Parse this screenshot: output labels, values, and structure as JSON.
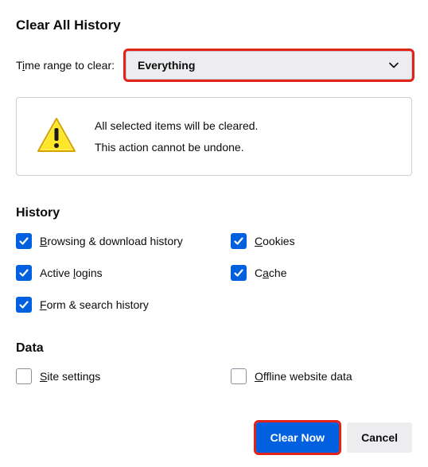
{
  "title": "Clear All History",
  "timeRange": {
    "label_pre": "T",
    "label_u": "i",
    "label_post": "me range to clear:",
    "selected": "Everything"
  },
  "warning": {
    "line1": "All selected items will be cleared.",
    "line2": "This action cannot be undone."
  },
  "sections": {
    "history": {
      "title": "History",
      "items": [
        {
          "u": "B",
          "rest": "rowsing & download history",
          "checked": true
        },
        {
          "u": "C",
          "rest": "ookies",
          "checked": true
        },
        {
          "pre": "Active ",
          "u": "l",
          "rest": "ogins",
          "checked": true
        },
        {
          "pre": "C",
          "u": "a",
          "rest": "che",
          "checked": true
        },
        {
          "u": "F",
          "rest": "orm & search history",
          "checked": true
        }
      ]
    },
    "data": {
      "title": "Data",
      "items": [
        {
          "u": "S",
          "rest": "ite settings",
          "checked": false
        },
        {
          "u": "O",
          "rest": "ffline website data",
          "checked": false
        }
      ]
    }
  },
  "buttons": {
    "clear": "Clear Now",
    "cancel": "Cancel"
  }
}
